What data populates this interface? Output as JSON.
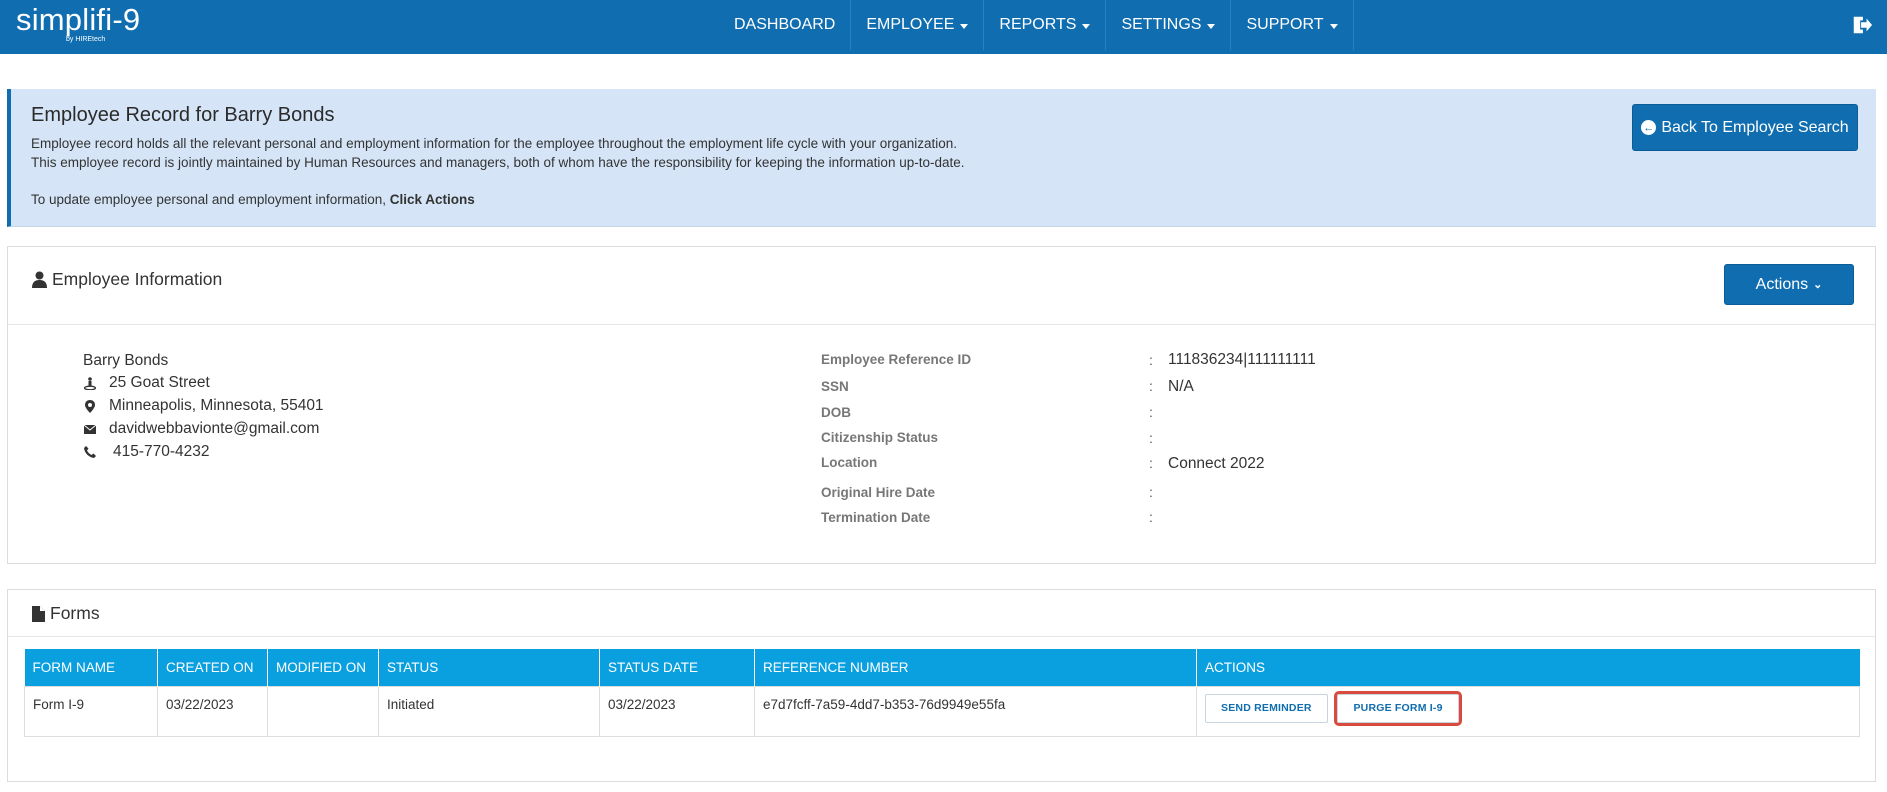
{
  "brand": {
    "name": "simplifi-9",
    "sub": "by HIREtech"
  },
  "nav": {
    "items": [
      {
        "label": "DASHBOARD",
        "dropdown": false
      },
      {
        "label": "EMPLOYEE",
        "dropdown": true
      },
      {
        "label": "REPORTS",
        "dropdown": true
      },
      {
        "label": "SETTINGS",
        "dropdown": true
      },
      {
        "label": "SUPPORT",
        "dropdown": true
      }
    ],
    "logout_icon": "logout-icon"
  },
  "info": {
    "title": "Employee Record for Barry Bonds",
    "line1": "Employee record holds all the relevant personal and employment information for the employee throughout the employment life cycle with your organization.",
    "line2": "This employee record is jointly maintained by Human Resources and managers, both of whom have the responsibility for keeping the information up-to-date.",
    "line3_prefix": "To update employee personal and employment information,",
    "line3_bold": "Click Actions",
    "back_button": "Back To Employee Search"
  },
  "employee": {
    "panel_title": "Employee Information",
    "actions_button": "Actions",
    "name": "Barry Bonds",
    "street": "25 Goat Street",
    "city": "Minneapolis, Minnesota, 55401",
    "email": "davidwebbavionte@gmail.com",
    "phone": "415-770-4232",
    "fields": [
      {
        "label": "Employee Reference ID",
        "value": "111836234|111111111"
      },
      {
        "label": "SSN",
        "value": "N/A"
      },
      {
        "label": "DOB",
        "value": ""
      },
      {
        "label": "Citizenship Status",
        "value": ""
      },
      {
        "label": "Location",
        "value": "Connect 2022"
      },
      {
        "label": "Original Hire Date",
        "value": ""
      },
      {
        "label": "Termination Date",
        "value": ""
      }
    ]
  },
  "forms": {
    "panel_title": "Forms",
    "columns": [
      "FORM NAME",
      "CREATED ON",
      "MODIFIED ON",
      "STATUS",
      "STATUS DATE",
      "REFERENCE NUMBER",
      "ACTIONS"
    ],
    "rows": [
      {
        "form_name": "Form I-9",
        "created_on": "03/22/2023",
        "modified_on": "",
        "status": "Initiated",
        "status_date": "03/22/2023",
        "reference_number": "e7d7fcff-7a59-4dd7-b353-76d9949e55fa",
        "send_reminder": "SEND REMINDER",
        "purge": "PURGE FORM I-9"
      }
    ]
  },
  "colors": {
    "navbar": "#0f6db0",
    "info_bg": "#d5e5f7",
    "table_header": "#0aa0e0",
    "highlight": "#d94b3d"
  }
}
